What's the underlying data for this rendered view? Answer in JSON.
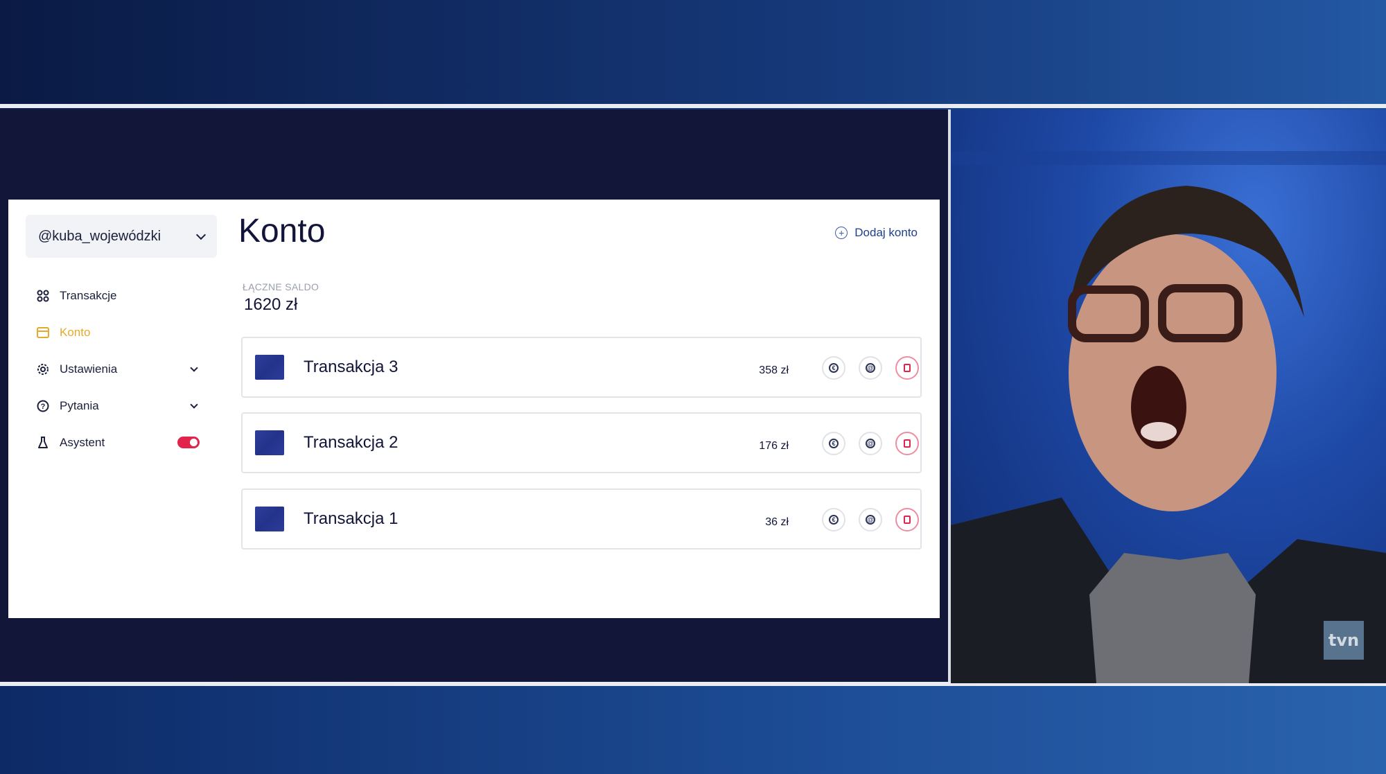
{
  "app": {
    "account_selector": "@kuba_wojewódzki",
    "sidebar": {
      "items": [
        {
          "label": "Transakcje",
          "icon": "grid-icon",
          "active": false
        },
        {
          "label": "Konto",
          "icon": "card-icon",
          "active": true
        },
        {
          "label": "Ustawienia",
          "icon": "gear-icon",
          "expandable": true
        },
        {
          "label": "Pytania",
          "icon": "question-icon",
          "expandable": true
        },
        {
          "label": "Asystent",
          "icon": "flask-icon",
          "toggle": true
        }
      ]
    },
    "page_title": "Konto",
    "add_account_label": "Dodaj konto",
    "balance": {
      "label": "ŁĄCZNE SALDO",
      "value": "1620 zł"
    },
    "transactions": [
      {
        "name": "Transakcja 3",
        "amount": "358 zł"
      },
      {
        "name": "Transakcja 2",
        "amount": "176 zł"
      },
      {
        "name": "Transakcja 1",
        "amount": "36 zł"
      }
    ],
    "colors": {
      "accent_active": "#e7a92b",
      "toggle_on": "#e0244b",
      "title": "#12143a"
    }
  },
  "broadcast": {
    "channel_logo": "tvn"
  }
}
